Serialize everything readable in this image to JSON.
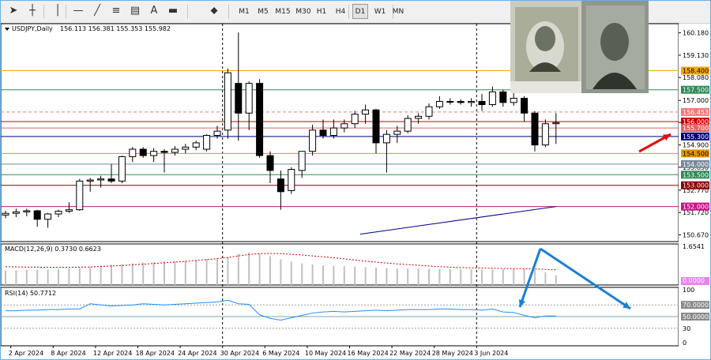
{
  "toolbar": {
    "timeframes": [
      {
        "label": "M1",
        "active": false
      },
      {
        "label": "M5",
        "active": false
      },
      {
        "label": "M15",
        "active": false
      },
      {
        "label": "M30",
        "active": false
      },
      {
        "label": "H1",
        "active": false
      },
      {
        "label": "H4",
        "active": false
      },
      {
        "label": "D1",
        "active": true
      },
      {
        "label": "W1",
        "active": false
      },
      {
        "label": "MN",
        "active": false
      }
    ],
    "tools": [
      {
        "name": "cursor-icon",
        "glyph": "➤"
      },
      {
        "name": "crosshair-icon",
        "glyph": "┼"
      },
      {
        "name": "vertical-line-icon",
        "glyph": "│"
      },
      {
        "name": "horizontal-line-icon",
        "glyph": "—"
      },
      {
        "name": "trendline-icon",
        "glyph": "╱"
      },
      {
        "name": "fibonacci-icon",
        "glyph": "≡"
      },
      {
        "name": "channel-icon",
        "glyph": "▤"
      },
      {
        "name": "text-icon",
        "glyph": "A"
      },
      {
        "name": "label-icon",
        "glyph": "▬"
      },
      {
        "name": "shapes-icon",
        "glyph": "⬥"
      }
    ]
  },
  "chart_data": {
    "type": "candlestick",
    "title": "USDJPY,Daily",
    "ohlc_header": "156.113 156.381 155.353 155.982",
    "price_axis": {
      "ylim": [
        150.35,
        160.5
      ],
      "ticks": [
        160.18,
        159.13,
        158.08,
        157.0,
        155.96,
        154.9,
        153.85,
        152.77,
        151.72,
        150.67
      ]
    },
    "x_labels": [
      {
        "label": "2 Apr 2024",
        "index": 0.5
      },
      {
        "label": "8 Apr 2024",
        "index": 4.5
      },
      {
        "label": "12 Apr 2024",
        "index": 8.5
      },
      {
        "label": "18 Apr 2024",
        "index": 12.5
      },
      {
        "label": "24 Apr 2024",
        "index": 16.5
      },
      {
        "label": "30 Apr 2024",
        "index": 20.5
      },
      {
        "label": "6 May 2024",
        "index": 24.5
      },
      {
        "label": "10 May 2024",
        "index": 28.5
      },
      {
        "label": "16 May 2024",
        "index": 32.5
      },
      {
        "label": "22 May 2024",
        "index": 36.5
      },
      {
        "label": "28 May 2024",
        "index": 40.5
      },
      {
        "label": "3 Jun 2024",
        "index": 44.5
      }
    ],
    "candles": [
      {
        "o": 151.6,
        "h": 151.8,
        "l": 151.45,
        "c": 151.68
      },
      {
        "o": 151.68,
        "h": 151.9,
        "l": 151.5,
        "c": 151.75
      },
      {
        "o": 151.75,
        "h": 151.9,
        "l": 151.55,
        "c": 151.8
      },
      {
        "o": 151.8,
        "h": 151.85,
        "l": 151.05,
        "c": 151.4
      },
      {
        "o": 151.4,
        "h": 151.7,
        "l": 151.0,
        "c": 151.65
      },
      {
        "o": 151.65,
        "h": 151.85,
        "l": 151.5,
        "c": 151.78
      },
      {
        "o": 151.78,
        "h": 152.2,
        "l": 151.7,
        "c": 151.85
      },
      {
        "o": 151.85,
        "h": 153.3,
        "l": 151.8,
        "c": 153.2
      },
      {
        "o": 153.2,
        "h": 153.35,
        "l": 152.7,
        "c": 153.25
      },
      {
        "o": 153.25,
        "h": 153.45,
        "l": 152.9,
        "c": 153.3
      },
      {
        "o": 153.3,
        "h": 154.0,
        "l": 153.1,
        "c": 153.2
      },
      {
        "o": 153.2,
        "h": 154.4,
        "l": 153.1,
        "c": 154.35
      },
      {
        "o": 154.35,
        "h": 154.8,
        "l": 154.1,
        "c": 154.7
      },
      {
        "o": 154.7,
        "h": 154.8,
        "l": 154.3,
        "c": 154.4
      },
      {
        "o": 154.4,
        "h": 154.75,
        "l": 154.1,
        "c": 154.6
      },
      {
        "o": 154.6,
        "h": 154.7,
        "l": 153.6,
        "c": 154.55
      },
      {
        "o": 154.55,
        "h": 154.85,
        "l": 154.4,
        "c": 154.7
      },
      {
        "o": 154.7,
        "h": 154.95,
        "l": 154.5,
        "c": 154.8
      },
      {
        "o": 154.8,
        "h": 155.1,
        "l": 154.65,
        "c": 155.0
      },
      {
        "o": 154.7,
        "h": 155.4,
        "l": 154.6,
        "c": 155.35
      },
      {
        "o": 155.35,
        "h": 155.8,
        "l": 155.2,
        "c": 155.55
      },
      {
        "o": 155.6,
        "h": 158.5,
        "l": 155.2,
        "c": 158.3
      },
      {
        "o": 157.8,
        "h": 160.2,
        "l": 155.1,
        "c": 156.4
      },
      {
        "o": 156.4,
        "h": 157.9,
        "l": 155.6,
        "c": 157.8
      },
      {
        "o": 157.8,
        "h": 158.0,
        "l": 154.3,
        "c": 154.4
      },
      {
        "o": 154.4,
        "h": 154.6,
        "l": 153.1,
        "c": 153.7
      },
      {
        "o": 153.3,
        "h": 153.7,
        "l": 151.85,
        "c": 152.7
      },
      {
        "o": 152.75,
        "h": 153.85,
        "l": 152.6,
        "c": 153.75
      },
      {
        "o": 153.7,
        "h": 154.6,
        "l": 153.35,
        "c": 154.6
      },
      {
        "o": 154.6,
        "h": 155.85,
        "l": 154.4,
        "c": 155.6
      },
      {
        "o": 155.6,
        "h": 156.1,
        "l": 155.2,
        "c": 155.35
      },
      {
        "o": 155.35,
        "h": 156.1,
        "l": 155.2,
        "c": 155.7
      },
      {
        "o": 155.7,
        "h": 156.1,
        "l": 155.5,
        "c": 155.9
      },
      {
        "o": 155.9,
        "h": 156.5,
        "l": 155.7,
        "c": 156.35
      },
      {
        "o": 156.35,
        "h": 156.8,
        "l": 155.9,
        "c": 156.55
      },
      {
        "o": 156.55,
        "h": 156.6,
        "l": 154.5,
        "c": 155.0
      },
      {
        "o": 155.0,
        "h": 155.6,
        "l": 153.6,
        "c": 155.4
      },
      {
        "o": 155.4,
        "h": 155.8,
        "l": 155.0,
        "c": 155.55
      },
      {
        "o": 155.55,
        "h": 156.3,
        "l": 155.45,
        "c": 156.15
      },
      {
        "o": 156.15,
        "h": 156.4,
        "l": 155.9,
        "c": 156.25
      },
      {
        "o": 156.25,
        "h": 156.85,
        "l": 156.1,
        "c": 156.7
      },
      {
        "o": 156.7,
        "h": 157.2,
        "l": 156.6,
        "c": 156.95
      },
      {
        "o": 156.95,
        "h": 157.1,
        "l": 156.8,
        "c": 156.95
      },
      {
        "o": 156.95,
        "h": 157.05,
        "l": 156.8,
        "c": 156.9
      },
      {
        "o": 156.9,
        "h": 157.1,
        "l": 156.7,
        "c": 156.95
      },
      {
        "o": 156.95,
        "h": 157.3,
        "l": 156.5,
        "c": 156.8
      },
      {
        "o": 156.8,
        "h": 157.65,
        "l": 156.7,
        "c": 157.4
      },
      {
        "o": 157.4,
        "h": 157.5,
        "l": 156.7,
        "c": 156.9
      },
      {
        "o": 156.9,
        "h": 157.4,
        "l": 156.75,
        "c": 157.1
      },
      {
        "o": 157.1,
        "h": 157.2,
        "l": 156.0,
        "c": 156.4
      },
      {
        "o": 156.4,
        "h": 156.5,
        "l": 154.6,
        "c": 154.9
      },
      {
        "o": 154.9,
        "h": 156.1,
        "l": 154.8,
        "c": 155.9
      },
      {
        "o": 155.9,
        "h": 156.4,
        "l": 154.95,
        "c": 155.95
      }
    ],
    "trendline": {
      "from": {
        "i": 33.5,
        "p": 150.7
      },
      "to": {
        "i": 52.0,
        "p": 152.0
      },
      "color": "#00008b"
    },
    "vlines": [
      20.5,
      44.5
    ],
    "levels": [
      {
        "price": 158.4,
        "label": "158.400",
        "color": "#f2a900",
        "text": "#000000"
      },
      {
        "price": 157.5,
        "label": "157.500",
        "color": "#2e8b57",
        "text": "#ffffff"
      },
      {
        "price": 156.453,
        "label": "156.453",
        "color": "#ef7a7a",
        "text": "#ffffff",
        "dashed": true
      },
      {
        "price": 156.0,
        "label": "156.000",
        "color": "#cc0000",
        "text": "#ffffff"
      },
      {
        "price": 155.7,
        "label": "155.700",
        "color": "#e06464",
        "text": "#ffffff"
      },
      {
        "price": 155.3,
        "label": "155.300",
        "color": "#000080",
        "text": "#ffffff"
      },
      {
        "price": 154.5,
        "label": "154.500",
        "color": "#e69500",
        "text": "#000000"
      },
      {
        "price": 154.0,
        "label": "154.000",
        "color": "#778899",
        "text": "#ffffff"
      },
      {
        "price": 153.5,
        "label": "153.500",
        "color": "#2e8b57",
        "text": "#ffffff"
      },
      {
        "price": 153.0,
        "label": "153.000",
        "color": "#8b0000",
        "text": "#ffffff"
      },
      {
        "price": 152.0,
        "label": "152.000",
        "color": "#c71585",
        "text": "#ffffff"
      }
    ],
    "macd": {
      "label": "MACD(12,26,9) 0.3730 0.6623",
      "ylim": [
        0,
        1.6541
      ],
      "axis_labels": [
        {
          "value": 1.6541,
          "label": "1.6541"
        },
        {
          "value": 0,
          "label": "0.0000",
          "badge": true,
          "color": "#ee82ee"
        }
      ],
      "hist": [
        0.62,
        0.64,
        0.66,
        0.67,
        0.68,
        0.7,
        0.72,
        0.74,
        0.78,
        0.84,
        0.88,
        0.92,
        0.95,
        0.98,
        1.0,
        1.02,
        1.04,
        1.07,
        1.1,
        1.13,
        1.16,
        1.22,
        1.36,
        1.42,
        1.36,
        1.26,
        1.12,
        1.02,
        0.94,
        0.9,
        0.86,
        0.84,
        0.82,
        0.8,
        0.78,
        0.76,
        0.74,
        0.72,
        0.72,
        0.71,
        0.7,
        0.7,
        0.69,
        0.68,
        0.68,
        0.67,
        0.68,
        0.69,
        0.7,
        0.7,
        0.66,
        0.56,
        0.42
      ],
      "signal": [
        0.8,
        0.79,
        0.78,
        0.78,
        0.77,
        0.77,
        0.77,
        0.78,
        0.79,
        0.81,
        0.83,
        0.85,
        0.88,
        0.91,
        0.94,
        0.97,
        1.0,
        1.03,
        1.07,
        1.11,
        1.15,
        1.2,
        1.27,
        1.33,
        1.37,
        1.38,
        1.37,
        1.34,
        1.31,
        1.27,
        1.23,
        1.19,
        1.14,
        1.09,
        1.04,
        1.0,
        0.96,
        0.92,
        0.89,
        0.86,
        0.83,
        0.8,
        0.78,
        0.76,
        0.75,
        0.74,
        0.73,
        0.72,
        0.72,
        0.71,
        0.7,
        0.68,
        0.66
      ]
    },
    "rsi": {
      "label": "RSI(14) 50.7712",
      "ylim": [
        0,
        100
      ],
      "ticks": [
        {
          "value": 100,
          "label": "100"
        },
        {
          "value": 70,
          "label": "70.0000",
          "badge": true
        },
        {
          "value": 50,
          "label": "50.0000",
          "badge": true
        },
        {
          "value": 30,
          "label": "30"
        },
        {
          "value": 0,
          "label": "0"
        }
      ],
      "values": [
        60,
        60,
        61,
        61,
        62,
        62,
        63,
        63,
        72,
        70,
        68,
        69,
        70,
        72,
        71,
        70,
        71,
        72,
        73,
        74,
        75,
        78,
        72,
        71,
        53,
        47,
        44,
        48,
        52,
        56,
        58,
        59,
        58,
        59,
        60,
        61,
        60,
        61,
        62,
        62,
        62,
        63,
        63,
        62,
        62,
        61,
        63,
        58,
        57,
        52,
        48,
        51,
        51
      ]
    },
    "arrows": [
      {
        "color": "#e01010",
        "from": [
          808,
          191
        ],
        "to": [
          848,
          169
        ]
      },
      {
        "color": "#1a7fd6",
        "from": [
          683,
          314
        ],
        "to": [
          657,
          388
        ]
      },
      {
        "color": "#1a7fd6",
        "from": [
          683,
          314
        ],
        "to": [
          797,
          390
        ]
      }
    ]
  }
}
